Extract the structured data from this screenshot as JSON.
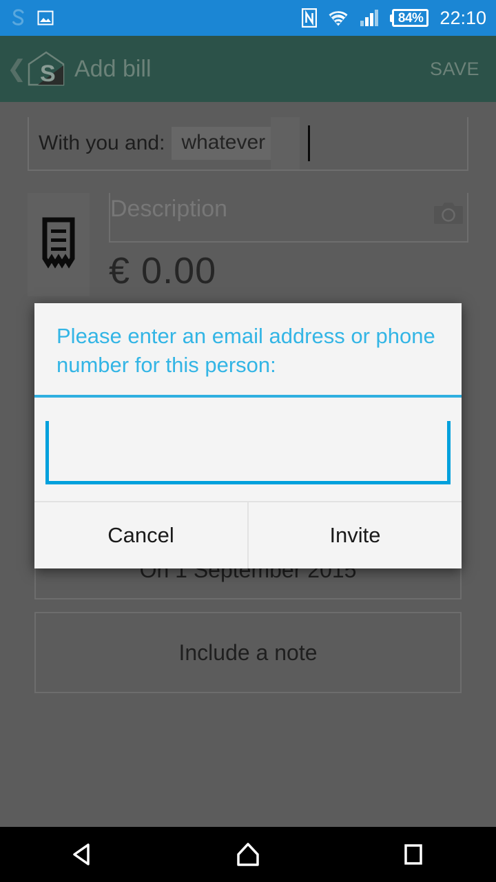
{
  "status_bar": {
    "background_color": "#1b86d4",
    "app_icon": "s-logo-icon",
    "gallery_icon": "gallery-icon",
    "nfc_icon": "nfc-icon",
    "wifi_icon": "wifi-icon",
    "signal_icon": "cellular-signal-icon",
    "battery_percent": "84%",
    "time": "22:10"
  },
  "app_bar": {
    "background_color": "#2c5249",
    "back_label": "❮",
    "logo_icon": "app-logo-icon",
    "title": "Add bill",
    "save_label": "SAVE"
  },
  "form": {
    "people_label": "With you and:",
    "person_chip": "whatever",
    "receipt_icon": "receipt-icon",
    "description_placeholder": "Description",
    "camera_icon": "camera-icon",
    "amount": "€ 0.00",
    "date_label": "On 1 September 2015",
    "note_label": "Include a note"
  },
  "dialog": {
    "title": "Please enter an email address or phone number for this person:",
    "title_color": "#33b5e5",
    "accent_color": "#00a0dc",
    "background_color": "#f4f4f4",
    "input_value": "",
    "input_placeholder": "",
    "cancel_label": "Cancel",
    "confirm_label": "Invite"
  },
  "nav_bar": {
    "back_icon": "nav-back-icon",
    "home_icon": "nav-home-icon",
    "recents_icon": "nav-recents-icon"
  }
}
